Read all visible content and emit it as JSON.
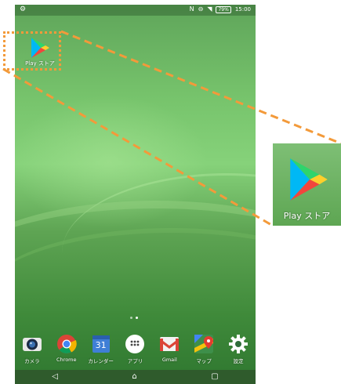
{
  "status_bar": {
    "time": "15:00",
    "battery": "79%"
  },
  "home_shortcut": {
    "label": "Play ストア",
    "icon": "play-store-icon"
  },
  "dock": [
    {
      "label": "カメラ",
      "icon": "camera-icon"
    },
    {
      "label": "Chrome",
      "icon": "chrome-icon"
    },
    {
      "label": "カレンダー",
      "icon": "calendar-icon",
      "number": "31"
    },
    {
      "label": "アプリ",
      "icon": "app-drawer-icon"
    },
    {
      "label": "Gmail",
      "icon": "gmail-icon"
    },
    {
      "label": "マップ",
      "icon": "maps-icon"
    },
    {
      "label": "設定",
      "icon": "settings-gear-icon"
    }
  ],
  "zoom_callout": {
    "label": "Play ストア",
    "highlight_color": "#f39a3a"
  },
  "colors": {
    "wallpaper": "#5ea453",
    "accent": "#f39a3a"
  }
}
